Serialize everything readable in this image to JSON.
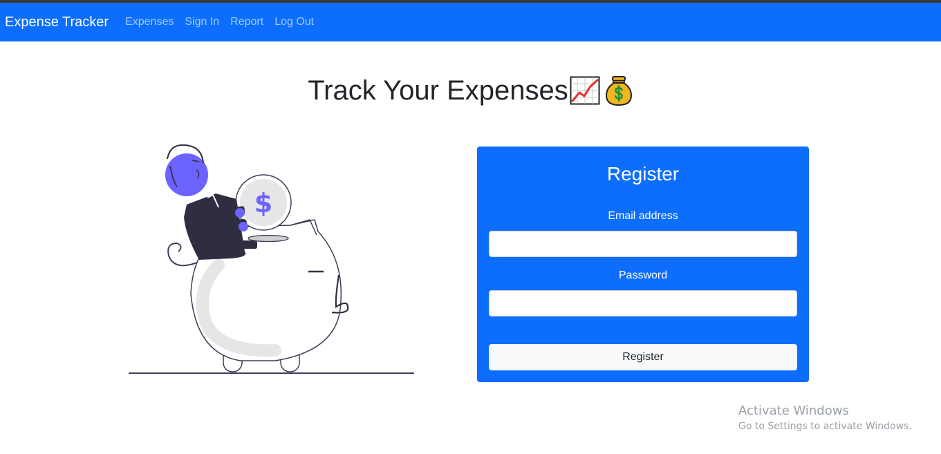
{
  "navbar": {
    "brand": "Expense Tracker",
    "links": [
      "Expenses",
      "Sign In",
      "Report",
      "Log Out"
    ]
  },
  "hero": {
    "title": "Track Your Expenses",
    "icons": [
      "chart-increasing-icon",
      "money-bag-icon"
    ]
  },
  "register_form": {
    "title": "Register",
    "email_label": "Email address",
    "email_value": "",
    "password_label": "Password",
    "password_value": "",
    "submit_label": "Register"
  },
  "watermark": {
    "title": "Activate Windows",
    "subtitle": "Go to Settings to activate Windows."
  },
  "colors": {
    "primary": "#0d6efd",
    "illustration_accent": "#6c63ff",
    "illustration_dark": "#2f2e41",
    "illustration_light": "#e6e6e6"
  }
}
